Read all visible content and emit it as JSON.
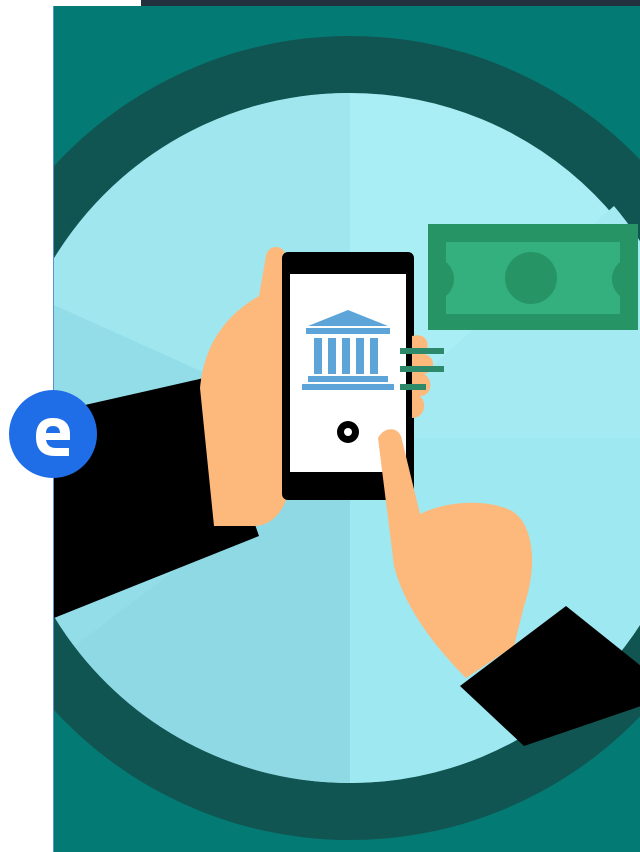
{
  "page": {
    "background": "#ffffff",
    "top_bar_color": "#23313f"
  },
  "story": {
    "illustration": "mobile-banking-illustration",
    "colors": {
      "background": "#047a74",
      "ring": "#115552",
      "dial_light": "#aaeef5",
      "dial_mid": "#9be5ef",
      "dial_dark": "#8fdce6",
      "phone_body": "#000000",
      "phone_screen": "#ffffff",
      "bank_icon": "#5da4d9",
      "banknote": "#279466",
      "banknote_inner": "#34b07e",
      "skin": "#fdb97b",
      "sleeve": "#000000",
      "signal_lines": "#2c8a6a"
    }
  },
  "badge": {
    "letter_icon": "e-logo-icon",
    "color": "#1f6ee8"
  }
}
